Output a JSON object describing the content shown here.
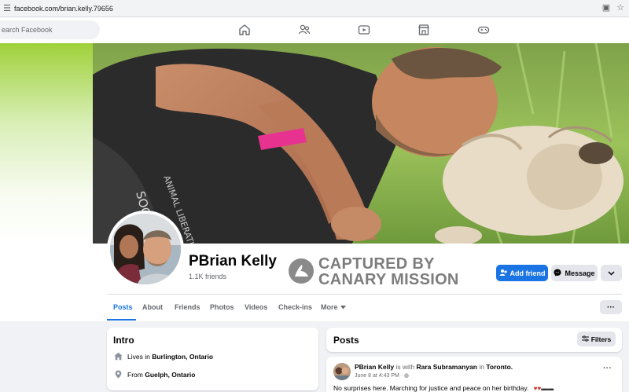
{
  "browser": {
    "url": "facebook.com/brian.kelly.79656"
  },
  "nav": {
    "search_placeholder": "earch Facebook",
    "icons": [
      "home-icon",
      "friends-icon",
      "video-icon",
      "marketplace-icon",
      "gaming-icon"
    ]
  },
  "profile": {
    "name": "PBrian Kelly",
    "friends": "1.1K friends",
    "watermark_line1": "CAPTURED BY",
    "watermark_line2": "CANARY MISSION",
    "add_friend_label": "Add friend",
    "message_label": "Message"
  },
  "tabs": [
    {
      "label": "Posts",
      "active": true
    },
    {
      "label": "About"
    },
    {
      "label": "Friends"
    },
    {
      "label": "Photos"
    },
    {
      "label": "Videos"
    },
    {
      "label": "Check-ins"
    },
    {
      "label": "More"
    }
  ],
  "intro": {
    "title": "Intro",
    "lives_prefix": "Lives in",
    "lives_city": "Burlington, Ontario",
    "from_prefix": "From",
    "from_city": "Guelph, Ontario"
  },
  "posts": {
    "title": "Posts",
    "filters_label": "Filters",
    "items": [
      {
        "author": "PBrian Kelly",
        "with_text": "is with",
        "with_name": "Rara Subramanyan",
        "in_text": "in",
        "location": "Toronto.",
        "meta": "June 8 at 4:43 PM ·",
        "body": "No surprises here.  Marching for justice and peace on her birthday."
      }
    ]
  },
  "colors": {
    "accent": "#1b74e4",
    "background": "#f0f2f5",
    "watermark": "#7d7d7d"
  }
}
